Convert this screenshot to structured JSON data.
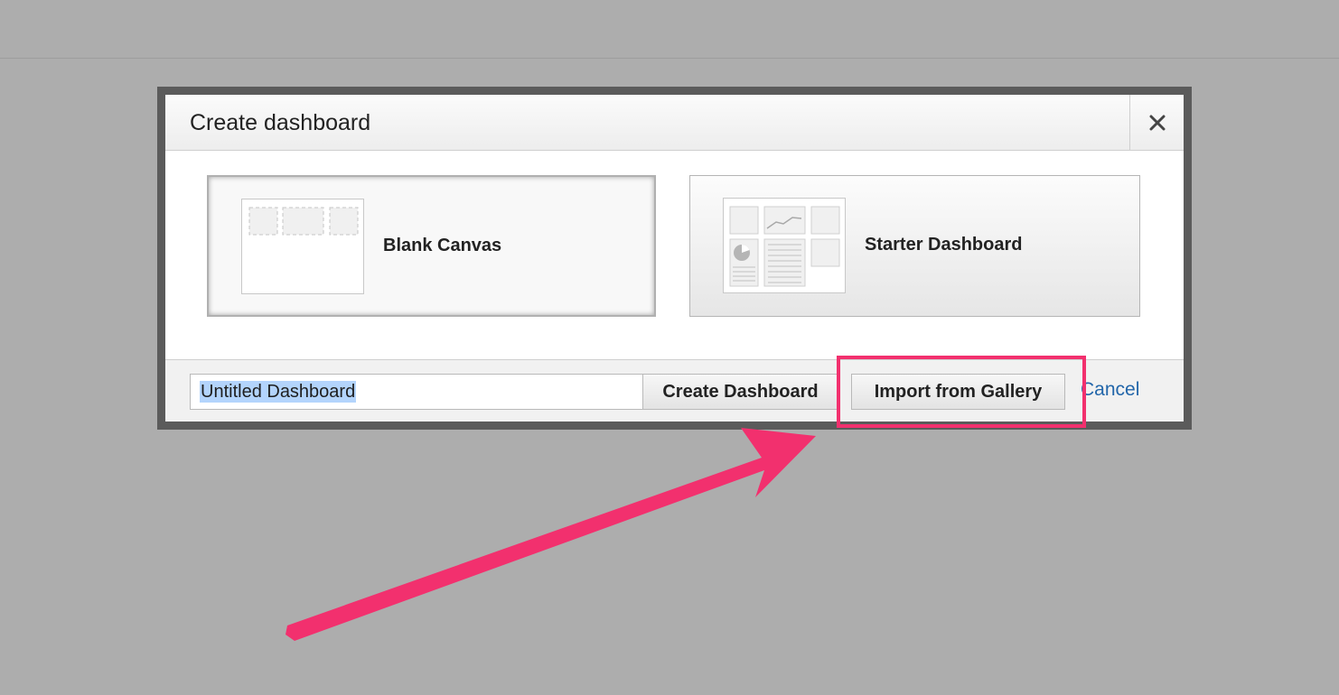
{
  "dialog": {
    "title": "Create dashboard",
    "close_icon": "close-icon"
  },
  "options": [
    {
      "label": "Blank Canvas",
      "icon": "blank-canvas-thumbnail-icon",
      "selected": true
    },
    {
      "label": "Starter Dashboard",
      "icon": "starter-dashboard-thumbnail-icon",
      "selected": false
    }
  ],
  "footer": {
    "name_input_value": "Untitled Dashboard",
    "create_label": "Create Dashboard",
    "import_label": "Import from Gallery",
    "cancel_label": "Cancel"
  },
  "annotation": {
    "color": "#f2306e",
    "highlight_target": "Import from Gallery"
  },
  "colors": {
    "backdrop": "#adadad",
    "dialog_frame": "#5b5b5b",
    "link": "#2266aa",
    "selection": "#b3d4fc"
  }
}
